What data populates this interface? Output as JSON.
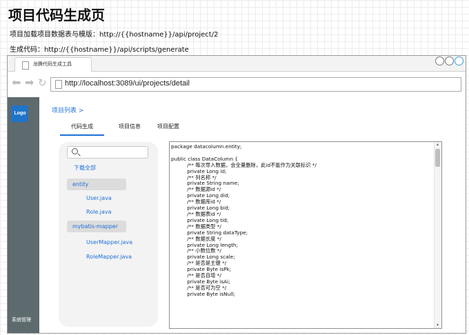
{
  "page": {
    "title": "项目代码生成页",
    "template_note": "项目加载项目数据表与模版：http://{{hostname}}/api/project/2",
    "generate_note": "生成代码：http://{{hostname}}/api/scripts/generate"
  },
  "browser": {
    "tab_title": "龙腾代码生成工具",
    "url": "http://localhost:3089/ui/projects/detail"
  },
  "sidebar": {
    "logo": "Logo",
    "system_menu": "系统管理"
  },
  "main": {
    "breadcrumb": "项目列表 >",
    "tabs": [
      {
        "label": "代码生成",
        "active": true
      },
      {
        "label": "项目信息",
        "active": false
      },
      {
        "label": "项目配置",
        "active": false
      }
    ]
  },
  "tree": {
    "search_value": "",
    "download_all": "下载全部",
    "folders": [
      {
        "name": "entity",
        "files": [
          "User.java",
          "Role.java"
        ]
      },
      {
        "name": "mybatis-mapper",
        "files": [
          "UserMapper.java",
          "RoleMapper.java"
        ]
      }
    ]
  },
  "code": {
    "lines": [
      "package datacolumn.entity;",
      "",
      "public class DataColumn {",
      "          /** 每次导入数据，会全量删除，此id不能作为关联标识 */",
      "          private Long id;",
      "          /** 列名称 */",
      "          private String name;",
      "          /** 数据源id */",
      "          private Long did;",
      "          /** 数据库id */",
      "          private Long bid;",
      "          /** 数据表id */",
      "          private Long tid;",
      "          /** 数据类型 */",
      "          private String dataType;",
      "          /** 数据长度 */",
      "          private Long length;",
      "          /** 小数位数 */",
      "          private Long scale;",
      "          /** 是否是主键 */",
      "          private Byte isPk;",
      "          /** 是否自增 */",
      "          private Byte isAi;",
      "          /** 是否可为空 */",
      "          private Byte isNull;"
    ]
  },
  "icons": {
    "back": "back-arrow-icon",
    "forward": "forward-arrow-icon",
    "reload": "reload-icon",
    "page": "document-icon",
    "search": "search-icon"
  },
  "colors": {
    "accent": "#1e6fd9",
    "sidebar": "#5d6b6f",
    "logo_bg": "#1f74c9"
  }
}
